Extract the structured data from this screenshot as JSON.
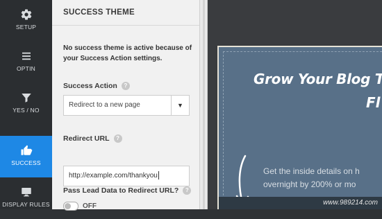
{
  "sidebar": {
    "items": [
      {
        "label": "SETUP",
        "icon": "gear-icon"
      },
      {
        "label": "OPTIN",
        "icon": "menu-icon"
      },
      {
        "label": "YES / NO",
        "icon": "filter-icon"
      },
      {
        "label": "SUCCESS",
        "icon": "thumbs-up-icon",
        "active": true
      },
      {
        "label": "DISPLAY RULES",
        "icon": "monitor-icon"
      }
    ]
  },
  "panel": {
    "title": "SUCCESS THEME",
    "notice": "No success theme is active because of your Success Action settings.",
    "success_action": {
      "label": "Success Action",
      "help": "?",
      "selected": "Redirect to a new page",
      "arrow": "▼"
    },
    "redirect_url": {
      "label": "Redirect URL",
      "help": "?",
      "value": "http://example.com/thankyou"
    },
    "pass_lead": {
      "label": "Pass Lead Data to Redirect URL?",
      "help": "?",
      "toggle_state": "OFF"
    }
  },
  "preview": {
    "headline": "Grow Your Blog T",
    "headline_line2": "Fl",
    "subtext_line1": "Get the inside details on h",
    "subtext_line2": "overnight by 200% or mo",
    "watermark": "www.989214.com"
  },
  "colors": {
    "active_accent": "#1e88e5",
    "sidebar_bg": "#2b2e31",
    "preview_bg": "#587088"
  }
}
